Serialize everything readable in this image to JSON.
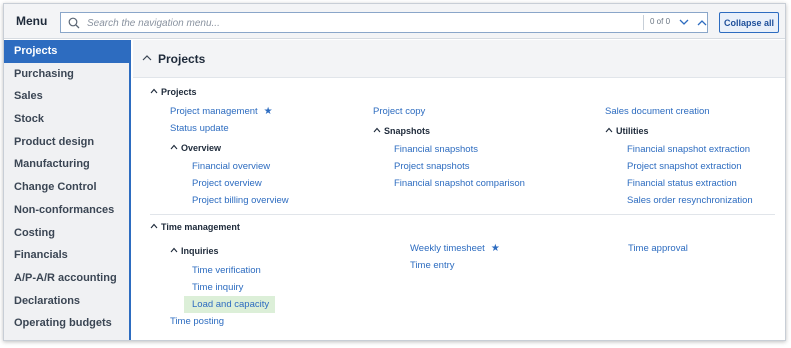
{
  "header": {
    "menu_label": "Menu",
    "search_placeholder": "Search the navigation menu...",
    "counter": "0 of 0",
    "collapse_label": "Collapse all"
  },
  "sidebar": {
    "items": [
      {
        "label": "Projects",
        "active": true
      },
      {
        "label": "Purchasing"
      },
      {
        "label": "Sales"
      },
      {
        "label": "Stock"
      },
      {
        "label": "Product design"
      },
      {
        "label": "Manufacturing"
      },
      {
        "label": "Change Control"
      },
      {
        "label": "Non-conformances"
      },
      {
        "label": "Costing"
      },
      {
        "label": "Financials"
      },
      {
        "label": "A/P-A/R accounting"
      },
      {
        "label": "Declarations"
      },
      {
        "label": "Operating budgets"
      }
    ]
  },
  "main": {
    "section_title": "Projects",
    "projects_group": {
      "title": "Projects",
      "project_management": "Project management",
      "status_update": "Status update",
      "overview_title": "Overview",
      "overview_links": [
        "Financial overview",
        "Project overview",
        "Project billing overview"
      ],
      "project_copy": "Project copy",
      "snapshots_title": "Snapshots",
      "snapshots_links": [
        "Financial snapshots",
        "Project snapshots",
        "Financial snapshot comparison"
      ],
      "sales_document_creation": "Sales document creation",
      "utilities_title": "Utilities",
      "utilities_links": [
        "Financial snapshot extraction",
        "Project snapshot extraction",
        "Financial status extraction",
        "Sales order resynchronization"
      ]
    },
    "time_group": {
      "title": "Time management",
      "inquiries_title": "Inquiries",
      "inquiries_links": [
        "Time verification",
        "Time inquiry",
        "Load and capacity"
      ],
      "time_posting": "Time posting",
      "weekly_timesheet": "Weekly timesheet",
      "time_entry": "Time entry",
      "time_approval": "Time approval"
    }
  },
  "colors": {
    "accent": "#2d6cc0",
    "highlight": "#dcefd8",
    "sidebar_bg": "#f0f1f3"
  }
}
